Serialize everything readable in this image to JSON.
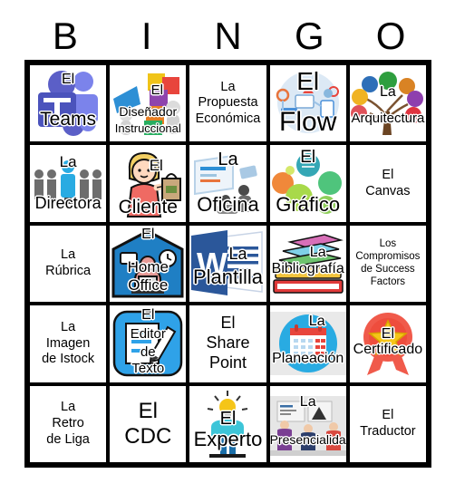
{
  "card": {
    "title": "BINGO",
    "header_letters": [
      "B",
      "I",
      "N",
      "G",
      "O"
    ],
    "columns": 5,
    "rows": 5,
    "grid_line_color": "#000000",
    "background_color": "#ffffff",
    "text_color": "#000000"
  },
  "cells": [
    {
      "id": "b1",
      "column": "B",
      "row": 1,
      "article": "El",
      "name": "Teams",
      "full_text": "El Teams",
      "type": "image",
      "icon": "microsoft-teams-logo",
      "accent_color": "#5b5fc7"
    },
    {
      "id": "i1",
      "column": "I",
      "row": 1,
      "article": "El",
      "name": "Diseñador Instruccional",
      "full_text": "El Diseñador Instruccional",
      "type": "image",
      "icon": "puzzle-people",
      "accent_color": "#9b30b0"
    },
    {
      "id": "n1",
      "column": "N",
      "row": 1,
      "article": "La",
      "name": "Propuesta Económica",
      "full_text": "La Propuesta Económica",
      "type": "text",
      "icon": "",
      "accent_color": "#000000"
    },
    {
      "id": "g1",
      "column": "G",
      "row": 1,
      "article": "El",
      "name": "Flow",
      "full_text": "El Flow",
      "type": "image",
      "icon": "flow-diagram",
      "accent_color": "#4a90d9"
    },
    {
      "id": "o1",
      "column": "O",
      "row": 1,
      "article": "La",
      "name": "Arquitectura",
      "full_text": "La Arquitectura",
      "type": "image",
      "icon": "tree-diagram",
      "accent_color": "#2e9e3e"
    },
    {
      "id": "b2",
      "column": "B",
      "row": 2,
      "article": "La",
      "name": "Directora",
      "full_text": "La Directora",
      "type": "image",
      "icon": "leader-people",
      "accent_color": "#29abe2"
    },
    {
      "id": "i2",
      "column": "I",
      "row": 2,
      "article": "El",
      "name": "Cliente",
      "full_text": "El Cliente",
      "type": "image",
      "icon": "woman-shopping-bag",
      "accent_color": "#ef6a63"
    },
    {
      "id": "n2",
      "column": "N",
      "row": 2,
      "article": "La",
      "name": "Oficina",
      "full_text": "La Oficina",
      "type": "image",
      "icon": "office-desk",
      "accent_color": "#7db6e8"
    },
    {
      "id": "g2",
      "column": "G",
      "row": 2,
      "article": "El",
      "name": "Gráfico",
      "full_text": "El Gráfico",
      "type": "image",
      "icon": "bubble-chart",
      "accent_color": "#8cc63e"
    },
    {
      "id": "o2",
      "column": "O",
      "row": 2,
      "article": "El",
      "name": "Canvas",
      "full_text": "El Canvas",
      "type": "text",
      "icon": "",
      "accent_color": "#000000"
    },
    {
      "id": "b3",
      "column": "B",
      "row": 3,
      "article": "La",
      "name": "Rúbrica",
      "full_text": "La Rúbrica",
      "type": "text",
      "icon": "",
      "accent_color": "#000000"
    },
    {
      "id": "i3",
      "column": "I",
      "row": 3,
      "article": "El",
      "name": "Home Office",
      "full_text": "El Home Office",
      "type": "image",
      "icon": "home-office-desk",
      "accent_color": "#1f7fc4"
    },
    {
      "id": "n3",
      "column": "N",
      "row": 3,
      "article": "La",
      "name": "Plantilla",
      "full_text": "La Plantilla",
      "type": "image",
      "icon": "microsoft-word-document",
      "accent_color": "#2b579a"
    },
    {
      "id": "g3",
      "column": "G",
      "row": 3,
      "article": "La",
      "name": "Bibliografía",
      "full_text": "La Bibliografía",
      "type": "image",
      "icon": "stack-of-books",
      "accent_color": "#e03a3a"
    },
    {
      "id": "o3",
      "column": "O",
      "row": 3,
      "article": "Los",
      "name": "Compromisos de Success Factors",
      "full_text": "Los Compromisos de Success Factors",
      "type": "text",
      "icon": "",
      "accent_color": "#000000"
    },
    {
      "id": "b4",
      "column": "B",
      "row": 4,
      "article": "La",
      "name": "Imagen de Istock",
      "full_text": "La Imagen de Istock",
      "type": "text",
      "icon": "",
      "accent_color": "#000000"
    },
    {
      "id": "i4",
      "column": "I",
      "row": 4,
      "article": "El",
      "name": "Editor de Texto",
      "full_text": "El Editor de Texto",
      "type": "image",
      "icon": "text-editor-pencil",
      "accent_color": "#2fa2e8"
    },
    {
      "id": "n4",
      "column": "N",
      "row": 4,
      "article": "El",
      "name": "Share Point",
      "full_text": "El Share Point",
      "type": "text",
      "icon": "",
      "accent_color": "#000000"
    },
    {
      "id": "g4",
      "column": "G",
      "row": 4,
      "article": "La",
      "name": "Planeación",
      "full_text": "La Planeación",
      "type": "image",
      "icon": "calendar",
      "accent_color": "#29abe2"
    },
    {
      "id": "o4",
      "column": "O",
      "row": 4,
      "article": "El",
      "name": "Certificado",
      "full_text": "El Certificado",
      "type": "image",
      "icon": "award-ribbon-star",
      "accent_color": "#f05a4b"
    },
    {
      "id": "b5",
      "column": "B",
      "row": 5,
      "article": "La",
      "name": "Retro de Liga",
      "full_text": "La Retro de Liga",
      "type": "text",
      "icon": "",
      "accent_color": "#000000"
    },
    {
      "id": "i5",
      "column": "I",
      "row": 5,
      "article": "El",
      "name": "CDC",
      "full_text": "El CDC",
      "type": "text",
      "icon": "",
      "accent_color": "#000000"
    },
    {
      "id": "n5",
      "column": "N",
      "row": 5,
      "article": "El",
      "name": "Experto",
      "full_text": "El Experto",
      "type": "image",
      "icon": "lightbulb-person",
      "accent_color": "#f5c518"
    },
    {
      "id": "g5",
      "column": "G",
      "row": 5,
      "article": "La",
      "name": "Presencialidad",
      "full_text": "La Presencialidad",
      "type": "image",
      "icon": "classroom-people",
      "accent_color": "#8a4a9e"
    },
    {
      "id": "o5",
      "column": "O",
      "row": 5,
      "article": "El",
      "name": "Traductor",
      "full_text": "El Traductor",
      "type": "text",
      "icon": "",
      "accent_color": "#000000"
    }
  ],
  "text_cells": {
    "n1": "La\nPropuesta\nEconómica",
    "o2": "El\nCanvas",
    "b3": "La\nRúbrica",
    "o3": "Los\nCompromisos\nde Success\nFactors",
    "b4": "La\nImagen\nde Istock",
    "n4": "El\nShare\nPoint",
    "b5": "La\nRetro\nde Liga",
    "i5": "El\nCDC",
    "o5": "El\nTraductor"
  }
}
